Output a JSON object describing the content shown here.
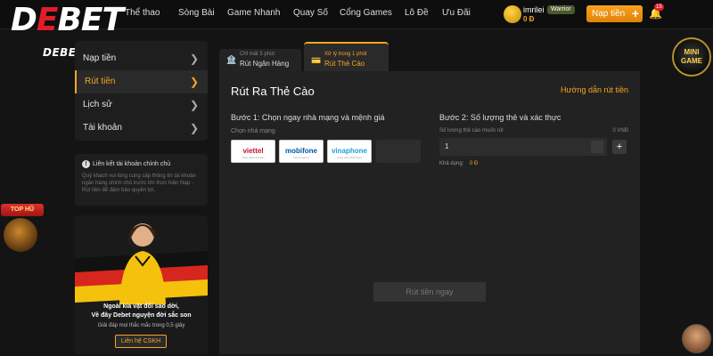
{
  "brand": {
    "logo_text": "DEBET",
    "logo_sub": "DEBETS.WORLD"
  },
  "nav": [
    {
      "label": "Thể thao"
    },
    {
      "label": "Sòng Bài"
    },
    {
      "label": "Game Nhanh"
    },
    {
      "label": "Quay Số"
    },
    {
      "label": "Cổng Games"
    },
    {
      "label": "Lô Đề"
    },
    {
      "label": "Ưu Đãi"
    }
  ],
  "user": {
    "name": "imrilei",
    "rank": "Warrior",
    "balance": "0 Đ",
    "notifications": "15"
  },
  "deposit_button": "Nạp tiền",
  "sidebar": {
    "items": [
      {
        "label": "Nạp tiền",
        "active": false
      },
      {
        "label": "Rút tiền",
        "active": true
      },
      {
        "label": "Lịch sử",
        "active": false
      },
      {
        "label": "Tài khoản",
        "active": false
      }
    ]
  },
  "notice": {
    "title": "Liên kết tài khoản chính chủ",
    "text": "Quý khách vui lòng cung cấp thông tin tài khoản ngân hàng chính chủ trước khi thực hiện Nạp - Rút tiền để đảm bảo quyền lợi."
  },
  "promo": {
    "line1": "Ngoài kia vật đổi sao dời,",
    "line2": "Về đây Debet nguyện đời sắc son",
    "line3": "Giải đáp mọi thắc mắc trong 0,5 giây",
    "button": "Liên hệ CSKH"
  },
  "widgets": {
    "top_hu": "TOP HŨ",
    "mini_game_line1": "MINI",
    "mini_game_line2": "GAME"
  },
  "tabs": [
    {
      "sub": "Chỉ mất 5 phút",
      "label": "Rút Ngân Hàng",
      "active": false
    },
    {
      "sub": "Xử lý trong 1 phút",
      "label": "Rút Thẻ Cào",
      "active": true
    }
  ],
  "panel": {
    "title": "Rút Ra Thẻ Cào",
    "guide_link": "Hướng dẫn rút tiền",
    "step1_title": "Bước 1: Chọn ngay nhà mạng và mệnh giá",
    "step1_sub": "Chọn nhà mạng",
    "carriers": [
      {
        "name": "viettel",
        "tagline": "Theo cách của bạn",
        "color": "#c8102e"
      },
      {
        "name": "mobifone",
        "tagline": "Kết nối giá trị",
        "color": "#0055a5"
      },
      {
        "name": "vinaphone",
        "tagline": "Cuộc sống đích thực",
        "color": "#1ba0e2"
      }
    ],
    "step2_title": "Bước 2: Số lượng thẻ và xác thực",
    "step2_sub": "Số lượng thẻ cào muốn rút",
    "step2_amount": "0 VNĐ",
    "quantity": "1",
    "balance_label": "Khả dụng:",
    "balance_value": "0 Đ",
    "submit": "Rút tiền ngay"
  },
  "colors": {
    "accent": "#f5a623",
    "brand_red": "#e11d2a",
    "panel_bg": "#222222"
  }
}
